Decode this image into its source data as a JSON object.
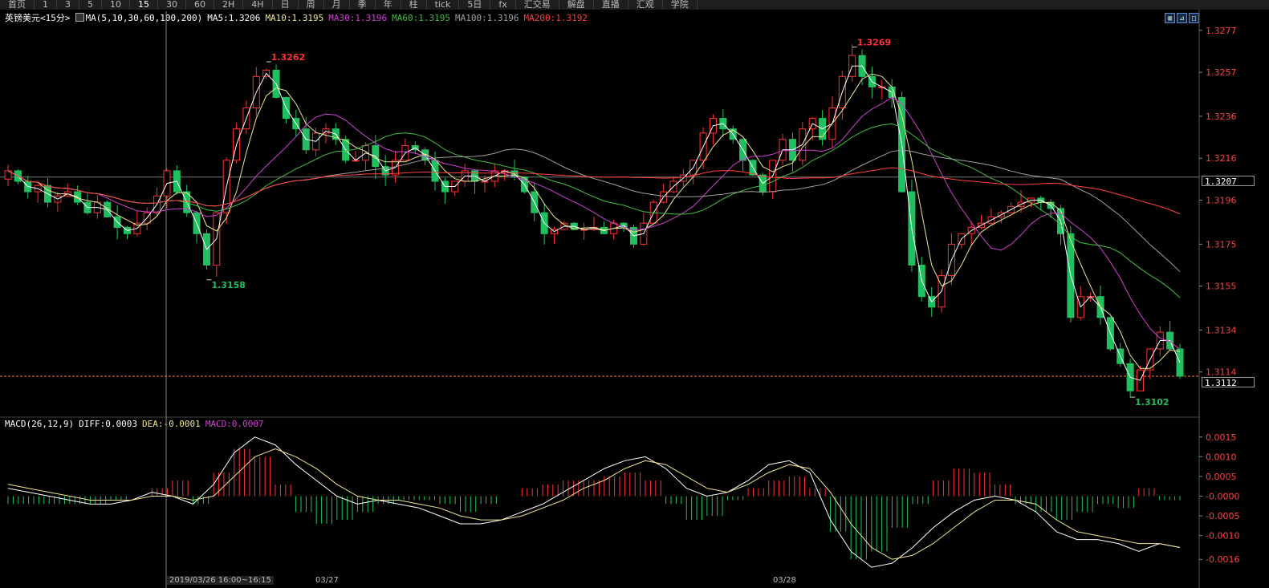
{
  "toolbar": {
    "items": [
      "首页",
      "1",
      "3",
      "5",
      "10",
      "15",
      "30",
      "60",
      "2H",
      "4H",
      "日",
      "周",
      "月",
      "季",
      "年",
      "柱",
      "tick",
      "5日",
      "fx",
      "汇交易",
      "解盘",
      "直播",
      "汇观",
      "学院"
    ],
    "active_index": 5,
    "icons": [
      "home-icon",
      "bars-icon",
      "candles-icon",
      "zoom-out-icon",
      "zoom-in-icon",
      "pen-icon",
      "chat-icon",
      "tv-icon",
      "glasses-icon",
      "academy-icon"
    ]
  },
  "header": {
    "symbol": "英镑美元<15分>",
    "ma_label": "MA(5,10,30,60,100,200)",
    "ma_values": [
      {
        "label": "MA5:1.3206",
        "color": "#ffffff"
      },
      {
        "label": "MA10:1.3195",
        "color": "#f0e68c"
      },
      {
        "label": "MA30:1.3196",
        "color": "#d040d0"
      },
      {
        "label": "MA60:1.3195",
        "color": "#40c040"
      },
      {
        "label": "MA100:1.3196",
        "color": "#a0a0a0"
      },
      {
        "label": "MA200:1.3192",
        "color": "#ff4040"
      }
    ]
  },
  "macd_header": {
    "label": "MACD(26,12,9)",
    "diff": "DIFF:0.0003",
    "dea": "DEA:-0.0001",
    "macd": "MACD:0.0007"
  },
  "price_boxes": {
    "reference": "1.3207",
    "current": "1.3112"
  },
  "x_labels": {
    "cursor": "2019/03/26 16:00~16:15",
    "d1": "03/27",
    "d2": "03/28"
  },
  "colors": {
    "up": "#ff3030",
    "down": "#20c060",
    "bg": "#000000",
    "grid": "#333333"
  },
  "chart_data": [
    {
      "type": "candlestick",
      "title": "英镑美元<15分>",
      "ylim": [
        1.3094,
        1.328
      ],
      "y_ticks": [
        1.3277,
        1.3257,
        1.3236,
        1.3216,
        1.3196,
        1.3175,
        1.3155,
        1.3134,
        1.3114
      ],
      "annotations": [
        {
          "label": "1.3262",
          "value": 1.3262,
          "kind": "high"
        },
        {
          "label": "1.3158",
          "value": 1.3158,
          "kind": "low"
        },
        {
          "label": "1.3269",
          "value": 1.3269,
          "kind": "high"
        },
        {
          "label": "1.3102",
          "value": 1.3102,
          "kind": "low"
        }
      ],
      "reference_line": 1.3207,
      "current_line": 1.3112,
      "close_path": [
        1.321,
        1.3205,
        1.32,
        1.3203,
        1.3195,
        1.3198,
        1.32,
        1.3195,
        1.319,
        1.3195,
        1.3188,
        1.3183,
        1.318,
        1.3185,
        1.319,
        1.3198,
        1.321,
        1.32,
        1.319,
        1.318,
        1.3165,
        1.319,
        1.3215,
        1.323,
        1.324,
        1.3255,
        1.3258,
        1.3245,
        1.3235,
        1.323,
        1.322,
        1.3228,
        1.323,
        1.3225,
        1.3215,
        1.3215,
        1.3222,
        1.3212,
        1.3208,
        1.3215,
        1.3222,
        1.322,
        1.3215,
        1.3205,
        1.32,
        1.3205,
        1.321,
        1.3205,
        1.3205,
        1.321,
        1.321,
        1.3207,
        1.32,
        1.319,
        1.318,
        1.3182,
        1.3185,
        1.3182,
        1.3182,
        1.3183,
        1.318,
        1.3185,
        1.3183,
        1.3175,
        1.3185,
        1.3195,
        1.32,
        1.3205,
        1.3208,
        1.3215,
        1.3228,
        1.3235,
        1.323,
        1.3225,
        1.3215,
        1.3208,
        1.32,
        1.3215,
        1.3225,
        1.3215,
        1.323,
        1.3235,
        1.3225,
        1.324,
        1.3255,
        1.3265,
        1.3255,
        1.325,
        1.325,
        1.3245,
        1.32,
        1.3165,
        1.315,
        1.3145,
        1.316,
        1.3175,
        1.318,
        1.3183,
        1.3185,
        1.3188,
        1.319,
        1.3193,
        1.3195,
        1.3197,
        1.3195,
        1.3192,
        1.318,
        1.314,
        1.315,
        1.315,
        1.314,
        1.3125,
        1.3118,
        1.3105,
        1.3115,
        1.3125,
        1.3133,
        1.3125,
        1.3112
      ]
    },
    {
      "type": "macd",
      "title": "MACD(26,12,9)",
      "ylim": [
        -0.0019,
        0.0018
      ],
      "y_ticks": [
        0.0015,
        0.001,
        0.0005,
        -0.0,
        -0.0005,
        -0.001,
        -0.0016
      ],
      "diff": [
        0.0002,
        0.0001,
        0.0,
        -0.0001,
        -0.0002,
        -0.0002,
        -0.0001,
        0.0001,
        0.0,
        -0.0002,
        0.0003,
        0.0011,
        0.0015,
        0.0013,
        0.0008,
        0.0004,
        0.0,
        -0.0002,
        -0.0001,
        -0.0002,
        -0.0003,
        -0.0005,
        -0.0007,
        -0.0007,
        -0.0006,
        -0.0004,
        -0.0002,
        0.0001,
        0.0004,
        0.0007,
        0.0009,
        0.001,
        0.0007,
        0.0002,
        0.0,
        0.0001,
        0.0004,
        0.0008,
        0.0009,
        0.0006,
        -0.0006,
        -0.0014,
        -0.0018,
        -0.0017,
        -0.0013,
        -0.0008,
        -0.0004,
        -0.0001,
        0.0,
        -0.0001,
        -0.0004,
        -0.0009,
        -0.0011,
        -0.0011,
        -0.0012,
        -0.0014,
        -0.0012,
        -0.0013
      ],
      "dea": [
        0.0003,
        0.0002,
        0.0001,
        0.0,
        -0.0001,
        -0.0001,
        -0.0001,
        0.0,
        0.0,
        -0.0001,
        0.0,
        0.0005,
        0.001,
        0.0012,
        0.001,
        0.0007,
        0.0003,
        0.0,
        -0.0001,
        -0.0001,
        -0.0002,
        -0.0003,
        -0.0005,
        -0.0006,
        -0.0006,
        -0.0005,
        -0.0003,
        -0.0001,
        0.0002,
        0.0004,
        0.0007,
        0.0009,
        0.0008,
        0.0005,
        0.0002,
        0.0001,
        0.0003,
        0.0006,
        0.0008,
        0.0007,
        0.0001,
        -0.0007,
        -0.0013,
        -0.0016,
        -0.0015,
        -0.0012,
        -0.0008,
        -0.0004,
        -0.0001,
        -0.0001,
        -0.0002,
        -0.0006,
        -0.0009,
        -0.001,
        -0.0011,
        -0.0012,
        -0.0012,
        -0.0013
      ],
      "hist": [
        -0.0002,
        -0.0002,
        -0.0002,
        -0.0002,
        -0.0002,
        -0.0001,
        0.0,
        0.0002,
        0.0004,
        -0.0002,
        0.0006,
        0.0012,
        0.001,
        0.0003,
        -0.0004,
        -0.0007,
        -0.0006,
        -0.0004,
        -0.0002,
        -0.0001,
        -0.0001,
        -0.0002,
        -0.0004,
        -0.0002,
        0.0,
        0.0002,
        0.0003,
        0.0004,
        0.0004,
        0.0005,
        0.0006,
        0.0004,
        -0.0002,
        -0.0006,
        -0.0005,
        -0.0001,
        0.0002,
        0.0004,
        0.0005,
        0.0002,
        -0.0009,
        -0.0016,
        -0.0014,
        -0.0008,
        -0.0002,
        0.0004,
        0.0007,
        0.0006,
        0.0003,
        -0.0002,
        -0.0004,
        -0.0006,
        -0.0004,
        -0.0002,
        -0.0003,
        0.0002,
        -0.0001,
        -0.0001
      ]
    }
  ]
}
